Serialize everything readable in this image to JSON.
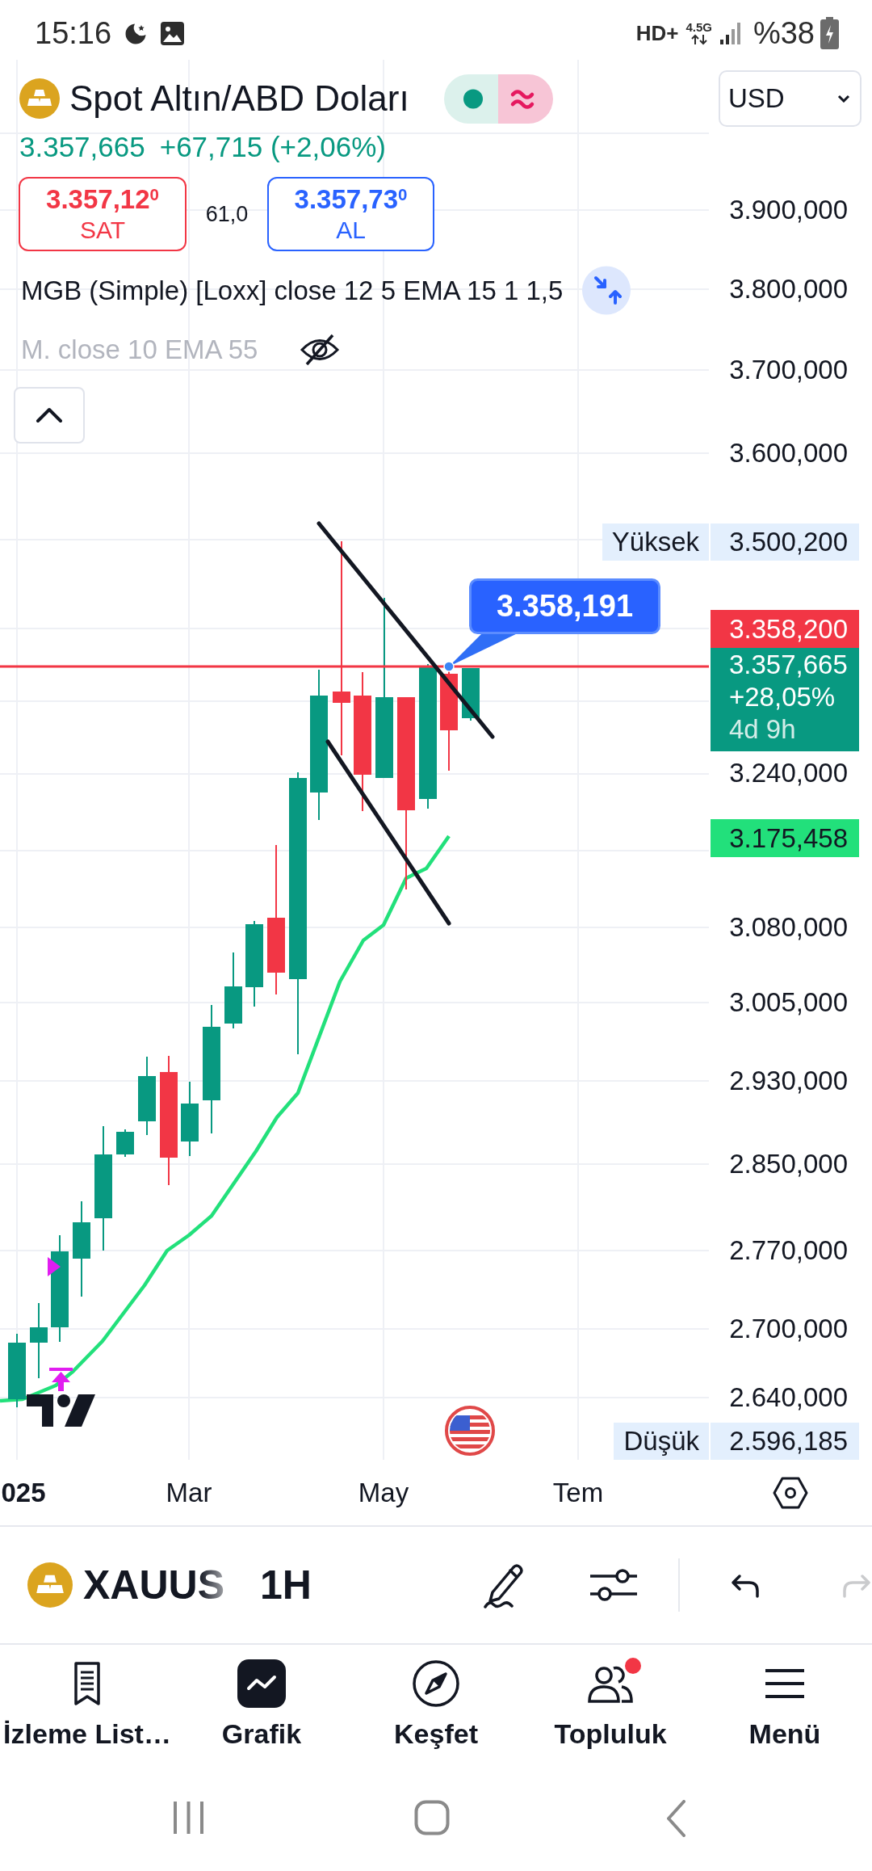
{
  "status_bar": {
    "time": "15:16",
    "hd_indicator": "HD+",
    "network": "4.5G",
    "battery": "%38"
  },
  "header": {
    "title": "Spot Altın/ABD Doları",
    "currency": "USD",
    "price": "3.357,665",
    "change": "+67,715 (+2,06%)"
  },
  "quote": {
    "sell": {
      "price": "3.357,12$^{0}$",
      "label": "SAT"
    },
    "spread": "61,0",
    "buy": {
      "price": "3.357,73$^{0}$",
      "label": "AL"
    }
  },
  "indicators": [
    {
      "label": "MGB (Simple) [Loxx] close 12 5 EMA 15 1 1,5",
      "hidden": false
    },
    {
      "label": "M. close 10 EMA 55",
      "hidden": true
    }
  ],
  "chart": {
    "price_axis": [
      "3.900,000",
      "3.800,000",
      "3.700,000",
      "3.600,000",
      "3.240,000",
      "3.080,000",
      "3.005,000",
      "2.930,000",
      "2.850,000",
      "2.770,000",
      "2.700,000",
      "2.640,000"
    ],
    "high": {
      "label": "Yüksek",
      "value": "3.500,200"
    },
    "price_line_label": "3.358,200",
    "last": {
      "price": "3.357,665",
      "change": "+28,05%",
      "countdown": "4d 9h"
    },
    "moving_average_label": "3.175,458",
    "low": {
      "label": "Düşük",
      "value": "2.596,185"
    },
    "callout": "3.358,191",
    "time_axis": [
      {
        "label": "025",
        "kind": "year"
      },
      {
        "label": "Mar",
        "kind": "month"
      },
      {
        "label": "May",
        "kind": "month"
      },
      {
        "label": "Tem",
        "kind": "month"
      }
    ]
  },
  "toolbar": {
    "symbol": "XAUUS",
    "interval": "1H",
    "history": [
      {
        "kind": "undo",
        "disabled": false
      },
      {
        "kind": "redo",
        "disabled": true
      }
    ]
  },
  "bottom_nav": [
    {
      "label": "İzleme List…",
      "selected": false,
      "notification": false
    },
    {
      "label": "Grafik",
      "selected": true,
      "notification": false
    },
    {
      "label": "Keşfet",
      "selected": false,
      "notification": false
    },
    {
      "label": "Topluluk",
      "selected": false,
      "notification": true
    },
    {
      "label": "Menü",
      "selected": false,
      "notification": false
    }
  ]
}
